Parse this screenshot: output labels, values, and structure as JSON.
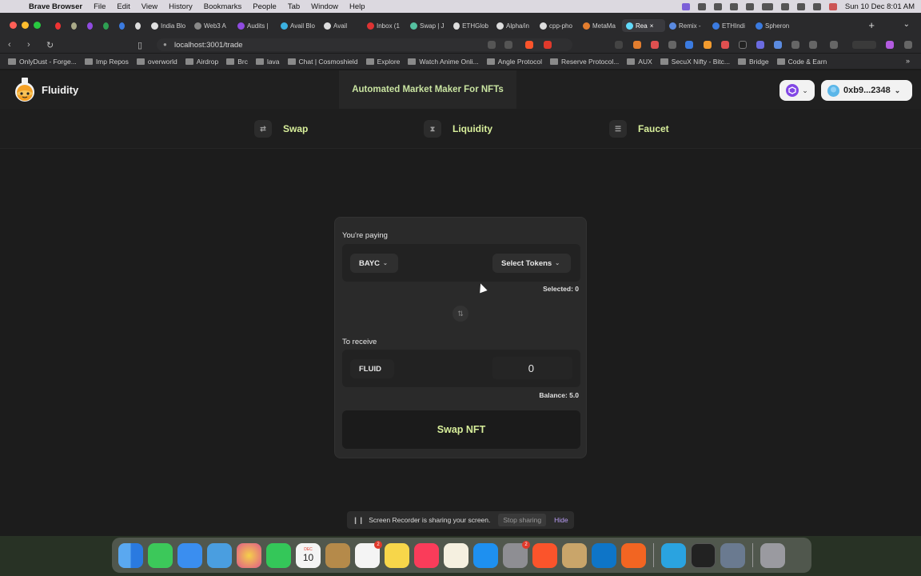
{
  "os_menubar": {
    "app_name": "Brave Browser",
    "items": [
      "File",
      "Edit",
      "View",
      "History",
      "Bookmarks",
      "People",
      "Tab",
      "Window",
      "Help"
    ],
    "clock": "Sun 10 Dec  8:01 AM"
  },
  "browser": {
    "tabs": [
      {
        "label": "",
        "color": "#e33"
      },
      {
        "label": "",
        "color": "#aa8"
      },
      {
        "label": "",
        "color": "#8f4be0"
      },
      {
        "label": "",
        "color": "#2e9f52"
      },
      {
        "label": "",
        "color": "#3b7be0"
      },
      {
        "label": "",
        "color": "#ddd"
      },
      {
        "label": "India Blo",
        "color": "#e0e0e0"
      },
      {
        "label": "Web3 A",
        "color": "#888"
      },
      {
        "label": "Audits |",
        "color": "#8f4be0"
      },
      {
        "label": "Avail Blo",
        "color": "#3bb0e0"
      },
      {
        "label": "Avail",
        "color": "#ddd"
      },
      {
        "label": "Inbox (1",
        "color": "#d33"
      },
      {
        "label": "Swap | J",
        "color": "#55c0a0"
      },
      {
        "label": "ETHGlob",
        "color": "#ddd"
      },
      {
        "label": "Alpha/in",
        "color": "#ddd"
      },
      {
        "label": "cpp-pho",
        "color": "#ddd"
      },
      {
        "label": "MetaMa",
        "color": "#e27d2e"
      },
      {
        "label": "Rea",
        "color": "#61dafb",
        "active": true
      },
      {
        "label": "Remix -",
        "color": "#5a8ae0"
      },
      {
        "label": "ETHIndi",
        "color": "#3b7be0"
      },
      {
        "label": "Spheron",
        "color": "#3b7be0"
      }
    ],
    "url": "localhost:3001/trade",
    "bookmarks": [
      "OnlyDust - Forge...",
      "Imp Repos",
      "overworld",
      "Airdrop",
      "Brc",
      "lava",
      "Chat | Cosmoshield",
      "Explore",
      "Watch Anime Onli...",
      "Angle Protocol",
      "Reserve Protocol...",
      "AUX",
      "SecuX Nifty - Bitc...",
      "Bridge",
      "Code & Earn"
    ]
  },
  "app": {
    "brand": "Fluidity",
    "banner": "Automated Market Maker For NFTs",
    "account": "0xb9...2348",
    "nav": [
      {
        "label": "Swap",
        "icon": "swap-arrows-icon"
      },
      {
        "label": "Liquidity",
        "icon": "hourglass-icon"
      },
      {
        "label": "Faucet",
        "icon": "faucet-icon"
      }
    ],
    "swap": {
      "paying_label": "You're paying",
      "pay_token": "BAYC",
      "select_tokens": "Select Tokens",
      "selected": "Selected: 0",
      "receive_label": "To receive",
      "receive_token": "FLUID",
      "receive_amount": "0",
      "balance": "Balance: 5.0",
      "button": "Swap NFT"
    }
  },
  "screen_share": {
    "message": "Screen Recorder is sharing your screen.",
    "stop": "Stop sharing",
    "hide": "Hide"
  },
  "dock": {
    "calendar_day": "10",
    "calendar_month": "DEC",
    "badge_count": "2"
  },
  "colors": {
    "accent": "#d8ef9b",
    "banner_text": "#c9e4a1",
    "background": "#1c1c1c",
    "card": "#2a2a2a"
  }
}
